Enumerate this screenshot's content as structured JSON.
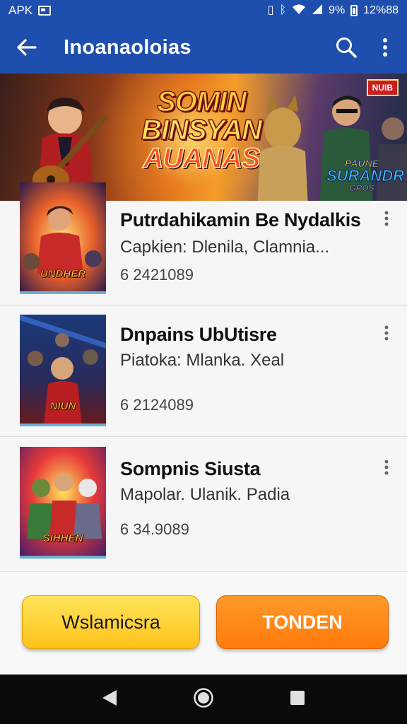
{
  "status_bar": {
    "left_text": "APK",
    "battery_text": "9%",
    "time": "12%88",
    "icons": [
      "image-icon",
      "vibrate-icon",
      "bluetooth-icon",
      "wifi-icon",
      "signal-icon",
      "battery-icon"
    ]
  },
  "app_bar": {
    "title": "Inoanaoloias",
    "back_icon": "arrow-left-icon",
    "search_icon": "search-icon",
    "more_icon": "more-vert-icon"
  },
  "banner": {
    "title_line1": "SOMIN",
    "title_line2": "BINSYAN",
    "title_line3": "AUANAS",
    "badge": "NUIB",
    "corner_line1": "PAUNE",
    "corner_line2": "SURANDR",
    "corner_line3": "GROS"
  },
  "items": [
    {
      "title": "Putrdahikamin Be Nydalkis",
      "subtitle": "Capkien: Dlenila, Clamnia...",
      "number": "6 2421089",
      "thumb_label": "UNDHER"
    },
    {
      "title": "Dnpains UbUtisre",
      "subtitle": "Piatoka: Mlanka. Xeal",
      "number": "6 2124089",
      "thumb_label": "NIUN"
    },
    {
      "title": "Sompnis Siusta",
      "subtitle": "Mapolar. Ulanik. Padia",
      "number": "6 34.9089",
      "thumb_label": "SIHHEN"
    }
  ],
  "actions": {
    "left_label": "Wslamicsra",
    "right_label": "TONDEN"
  },
  "colors": {
    "app_bar": "#1f4fae",
    "btn_yellow": "#ffcc2a",
    "btn_orange": "#ff8a14",
    "nav_bar": "#0a0a0a"
  }
}
